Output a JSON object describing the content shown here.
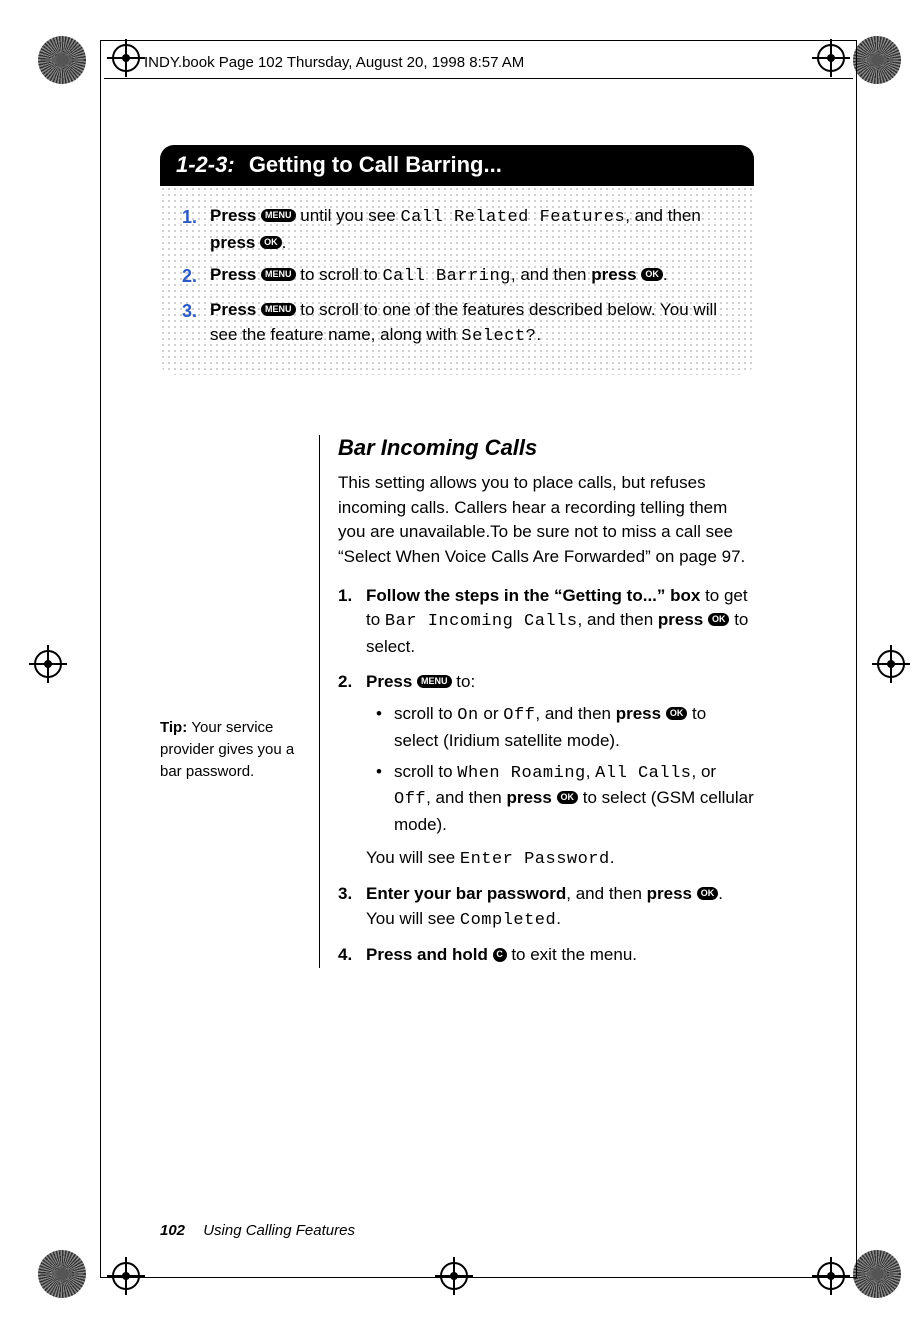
{
  "print_header": "INDY.book  Page 102  Thursday, August 20, 1998  8:57 AM",
  "heading": {
    "lead": "1-2-3:",
    "title": "Getting to Call Barring..."
  },
  "box_steps": [
    {
      "num": "1.",
      "parts": [
        {
          "b": true,
          "t": "Press "
        },
        {
          "key": "MENU"
        },
        {
          "t": " until you see "
        },
        {
          "lcd": true,
          "t": "Call Related Features"
        },
        {
          "t": ", and then "
        },
        {
          "b": true,
          "t": "press "
        },
        {
          "key": "OK"
        },
        {
          "t": "."
        }
      ]
    },
    {
      "num": "2.",
      "parts": [
        {
          "b": true,
          "t": "Press "
        },
        {
          "key": "MENU"
        },
        {
          "t": " to scroll to "
        },
        {
          "lcd": true,
          "t": "Call Barring"
        },
        {
          "t": ", and then "
        },
        {
          "b": true,
          "t": "press "
        },
        {
          "key": "OK"
        },
        {
          "t": "."
        }
      ]
    },
    {
      "num": "3.",
      "parts": [
        {
          "b": true,
          "t": "Press "
        },
        {
          "key": "MENU"
        },
        {
          "t": " to scroll to one of the features described below. You will see the feature name, along with "
        },
        {
          "lcd": true,
          "t": "Select?"
        },
        {
          "t": "."
        }
      ]
    }
  ],
  "tip": {
    "lead": "Tip: ",
    "text": "Your service provider gives you a bar password."
  },
  "section_title": "Bar Incoming Calls",
  "intro": "This setting allows you to place calls, but refuses incoming calls. Callers hear a recording telling them you are unavailable.To be sure not to miss a call see “Select When Voice Calls Are Forwarded” on page 97.",
  "main_steps": [
    {
      "num": "1.",
      "parts": [
        {
          "b": true,
          "t": "Follow the steps in the “Getting to...” box"
        },
        {
          "t": " to get to "
        },
        {
          "lcd": true,
          "t": "Bar Incoming Calls"
        },
        {
          "t": ", and then "
        },
        {
          "b": true,
          "t": "press "
        },
        {
          "key": "OK"
        },
        {
          "t": " to select."
        }
      ]
    },
    {
      "num": "2.",
      "parts": [
        {
          "b": true,
          "t": "Press "
        },
        {
          "key": "MENU"
        },
        {
          "t": " to:"
        }
      ],
      "bullets": [
        [
          {
            "t": "scroll to "
          },
          {
            "lcd": true,
            "t": "On"
          },
          {
            "t": " or "
          },
          {
            "lcd": true,
            "t": "Off"
          },
          {
            "t": ", and then "
          },
          {
            "b": true,
            "t": "press "
          },
          {
            "key": "OK"
          },
          {
            "t": " to select (Iridium satellite mode)."
          }
        ],
        [
          {
            "t": "scroll to "
          },
          {
            "lcd": true,
            "t": "When Roaming"
          },
          {
            "t": ", "
          },
          {
            "lcd": true,
            "t": "All Calls"
          },
          {
            "t": ", or "
          },
          {
            "lcd": true,
            "t": "Off"
          },
          {
            "t": ", and then "
          },
          {
            "b": true,
            "t": "press "
          },
          {
            "key": "OK"
          },
          {
            "t": " to select (GSM cellular mode)."
          }
        ]
      ],
      "tail": [
        {
          "t": "You will see "
        },
        {
          "lcd": true,
          "t": "Enter Password"
        },
        {
          "t": "."
        }
      ]
    },
    {
      "num": "3.",
      "parts": [
        {
          "b": true,
          "t": "Enter your bar password"
        },
        {
          "t": ", and then "
        },
        {
          "b": true,
          "t": "press "
        },
        {
          "key": "OK"
        },
        {
          "t": ". You will see "
        },
        {
          "lcd": true,
          "t": "Completed"
        },
        {
          "t": "."
        }
      ]
    },
    {
      "num": "4.",
      "parts": [
        {
          "b": true,
          "t": "Press and hold "
        },
        {
          "key": "C",
          "round": true
        },
        {
          "t": " to exit the menu."
        }
      ]
    }
  ],
  "footer": {
    "page": "102",
    "section": "Using Calling Features"
  }
}
